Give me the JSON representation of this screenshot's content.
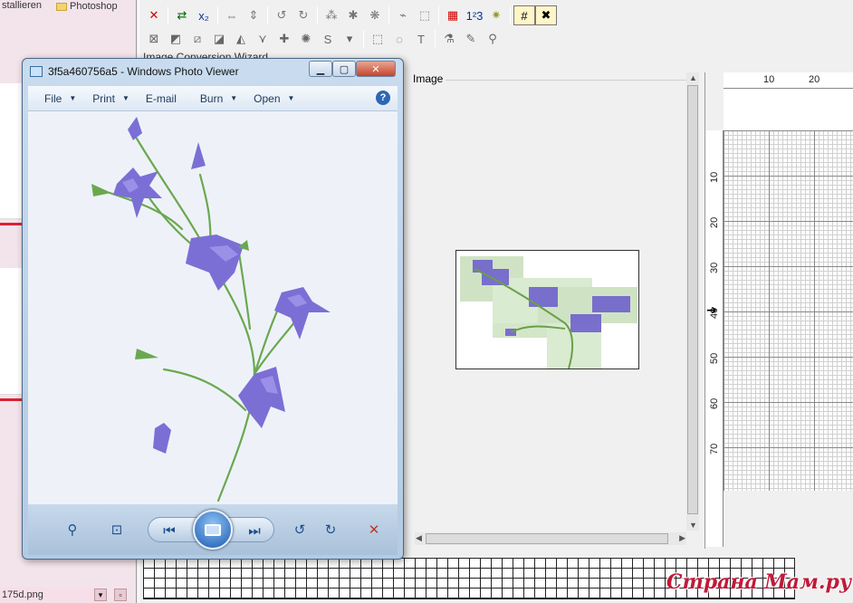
{
  "background": {
    "tab_left": "stallieren",
    "tab_folder": "Photoshop",
    "bottom_file": "175d.png",
    "bottom_buttons": [
      "▾",
      "▫"
    ]
  },
  "editor": {
    "toolbar_row1": [
      {
        "icon": "close-x-icon",
        "glyph": "✕",
        "color": "#cc0000"
      },
      {
        "icon": "color-swap-icon",
        "glyph": "⇄",
        "color": "#006600"
      },
      {
        "icon": "x2-icon",
        "glyph": "x₂",
        "color": "#003399"
      },
      {
        "icon": "flip-horizontal-icon",
        "glyph": "⇔",
        "color": "#777777"
      },
      {
        "icon": "flip-vertical-icon",
        "glyph": "⇕",
        "color": "#777777"
      },
      {
        "icon": "rotate-left-icon",
        "glyph": "↺",
        "color": "#777777"
      },
      {
        "icon": "rotate-right-icon",
        "glyph": "↻",
        "color": "#777777"
      },
      {
        "icon": "stitch-a-icon",
        "glyph": "⁂",
        "color": "#777777"
      },
      {
        "icon": "stitch-b-icon",
        "glyph": "✱",
        "color": "#777777"
      },
      {
        "icon": "stitch-c-icon",
        "glyph": "❋",
        "color": "#777777"
      },
      {
        "icon": "stitch-d-icon",
        "glyph": "⌁",
        "color": "#777777"
      },
      {
        "icon": "select-area-icon",
        "glyph": "⬚",
        "color": "#777777"
      },
      {
        "icon": "color-palette-icon",
        "glyph": "▦",
        "color": "#cc0000"
      },
      {
        "icon": "numbers-icon",
        "glyph": "1²3",
        "color": "#003399"
      },
      {
        "icon": "sparkle-icon",
        "glyph": "✷",
        "color": "#999933"
      },
      {
        "icon": "grid-icon",
        "glyph": "#",
        "color": "#000000",
        "active": true
      },
      {
        "icon": "cross-stitch-icon",
        "glyph": "✖",
        "color": "#000000",
        "active": true
      }
    ],
    "toolbar_row2": [
      {
        "icon": "full-stitch-icon",
        "glyph": "⊠"
      },
      {
        "icon": "half-stitch-a-icon",
        "glyph": "◩"
      },
      {
        "icon": "half-stitch-b-icon",
        "glyph": "⧄"
      },
      {
        "icon": "quarter-stitch-icon",
        "glyph": "◪"
      },
      {
        "icon": "three-quarter-stitch-icon",
        "glyph": "◭"
      },
      {
        "icon": "petite-stitch-icon",
        "glyph": "⋎"
      },
      {
        "icon": "french-knot-icon",
        "glyph": "✚"
      },
      {
        "icon": "bead-icon",
        "glyph": "✺"
      },
      {
        "icon": "backstitch-icon",
        "glyph": "S"
      },
      {
        "icon": "dropdown-icon",
        "glyph": "▾"
      },
      {
        "icon": "rect-select-icon",
        "glyph": "⬚"
      },
      {
        "icon": "lasso-select-icon",
        "glyph": "◌"
      },
      {
        "icon": "text-tool-icon",
        "glyph": "T"
      },
      {
        "icon": "paint-bucket-icon",
        "glyph": "⚗"
      },
      {
        "icon": "eyedropper-icon",
        "glyph": "✎"
      },
      {
        "icon": "zoom-icon",
        "glyph": "⚲"
      }
    ],
    "image_panel": {
      "legend": "Image"
    },
    "ruler_top": [
      "10",
      "20"
    ],
    "ruler_left": [
      "10",
      "20",
      "30",
      "40",
      "50",
      "60",
      "70"
    ],
    "partial_title": "Image Conversion Wizard"
  },
  "photo_viewer": {
    "title": "3f5a460756a5 - Windows Photo Viewer",
    "window_buttons": {
      "minimize": "▁",
      "maximize": "▢",
      "close": "✕"
    },
    "menu": [
      {
        "label": "File"
      },
      {
        "label": "Print"
      },
      {
        "label": "E-mail"
      },
      {
        "label": "Burn"
      },
      {
        "label": "Open"
      }
    ],
    "help": "?",
    "caret": "▼",
    "controls": {
      "zoom": "⚲",
      "fit": "⊡",
      "previous": "⏮",
      "next": "⏭",
      "rotate_left": "↺",
      "rotate_right": "↻",
      "delete": "✕"
    }
  },
  "watermark": "Страна Мам.ру"
}
